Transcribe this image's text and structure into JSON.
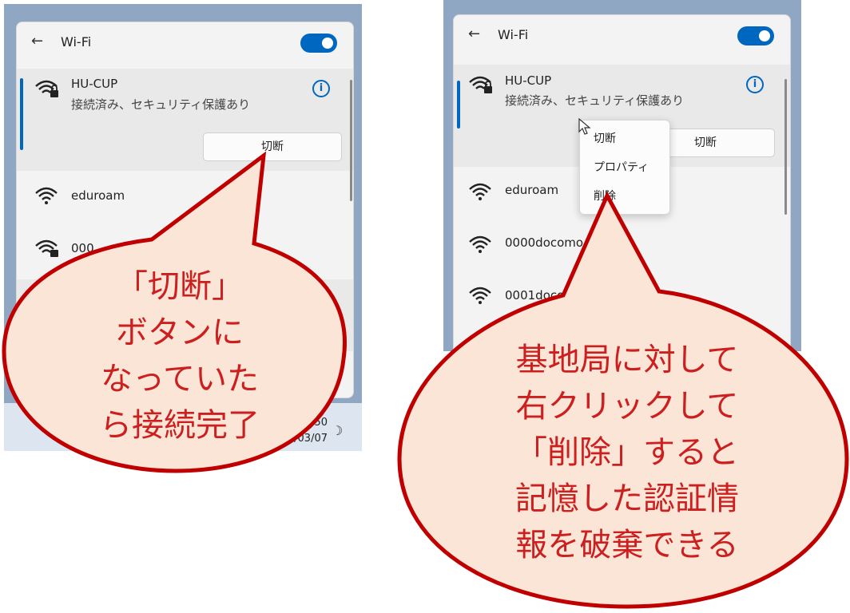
{
  "left_panel": {
    "header": {
      "back_icon": "←",
      "title": "Wi-Fi"
    },
    "networks": [
      {
        "name": "HU-CUP",
        "status": "接続済み、セキュリティ保護あり",
        "secured": true,
        "action": "切断"
      },
      {
        "name": "eduroam",
        "secured": false
      },
      {
        "name": "000",
        "secured": true
      }
    ],
    "taskbar": {
      "time": ":50",
      "date": "2/03/07",
      "moon_icon": "☽"
    }
  },
  "right_panel": {
    "header": {
      "back_icon": "←",
      "title": "Wi-Fi"
    },
    "networks": [
      {
        "name": "HU-CUP",
        "status": "接続済み、セキュリティ保護あり",
        "secured": true,
        "action": "切断"
      },
      {
        "name": "eduroam",
        "secured": false
      },
      {
        "name": "0000docomo",
        "secured": false
      },
      {
        "name": "0001doco",
        "secured": false
      }
    ],
    "context_menu": [
      "切断",
      "プロパティ",
      "削除"
    ]
  },
  "callouts": {
    "left": [
      "「切断」",
      "ボタンに",
      "なっていた",
      "ら接続完了"
    ],
    "right": [
      "基地局に対して",
      "右クリックして",
      "「削除」すると",
      "記憶した認証情",
      "報を破棄できる"
    ]
  },
  "colors": {
    "accent": "#0067c0",
    "callout_fill": "#fbe5d6",
    "callout_stroke": "#c00000",
    "callout_text": "#cc1f1f"
  }
}
